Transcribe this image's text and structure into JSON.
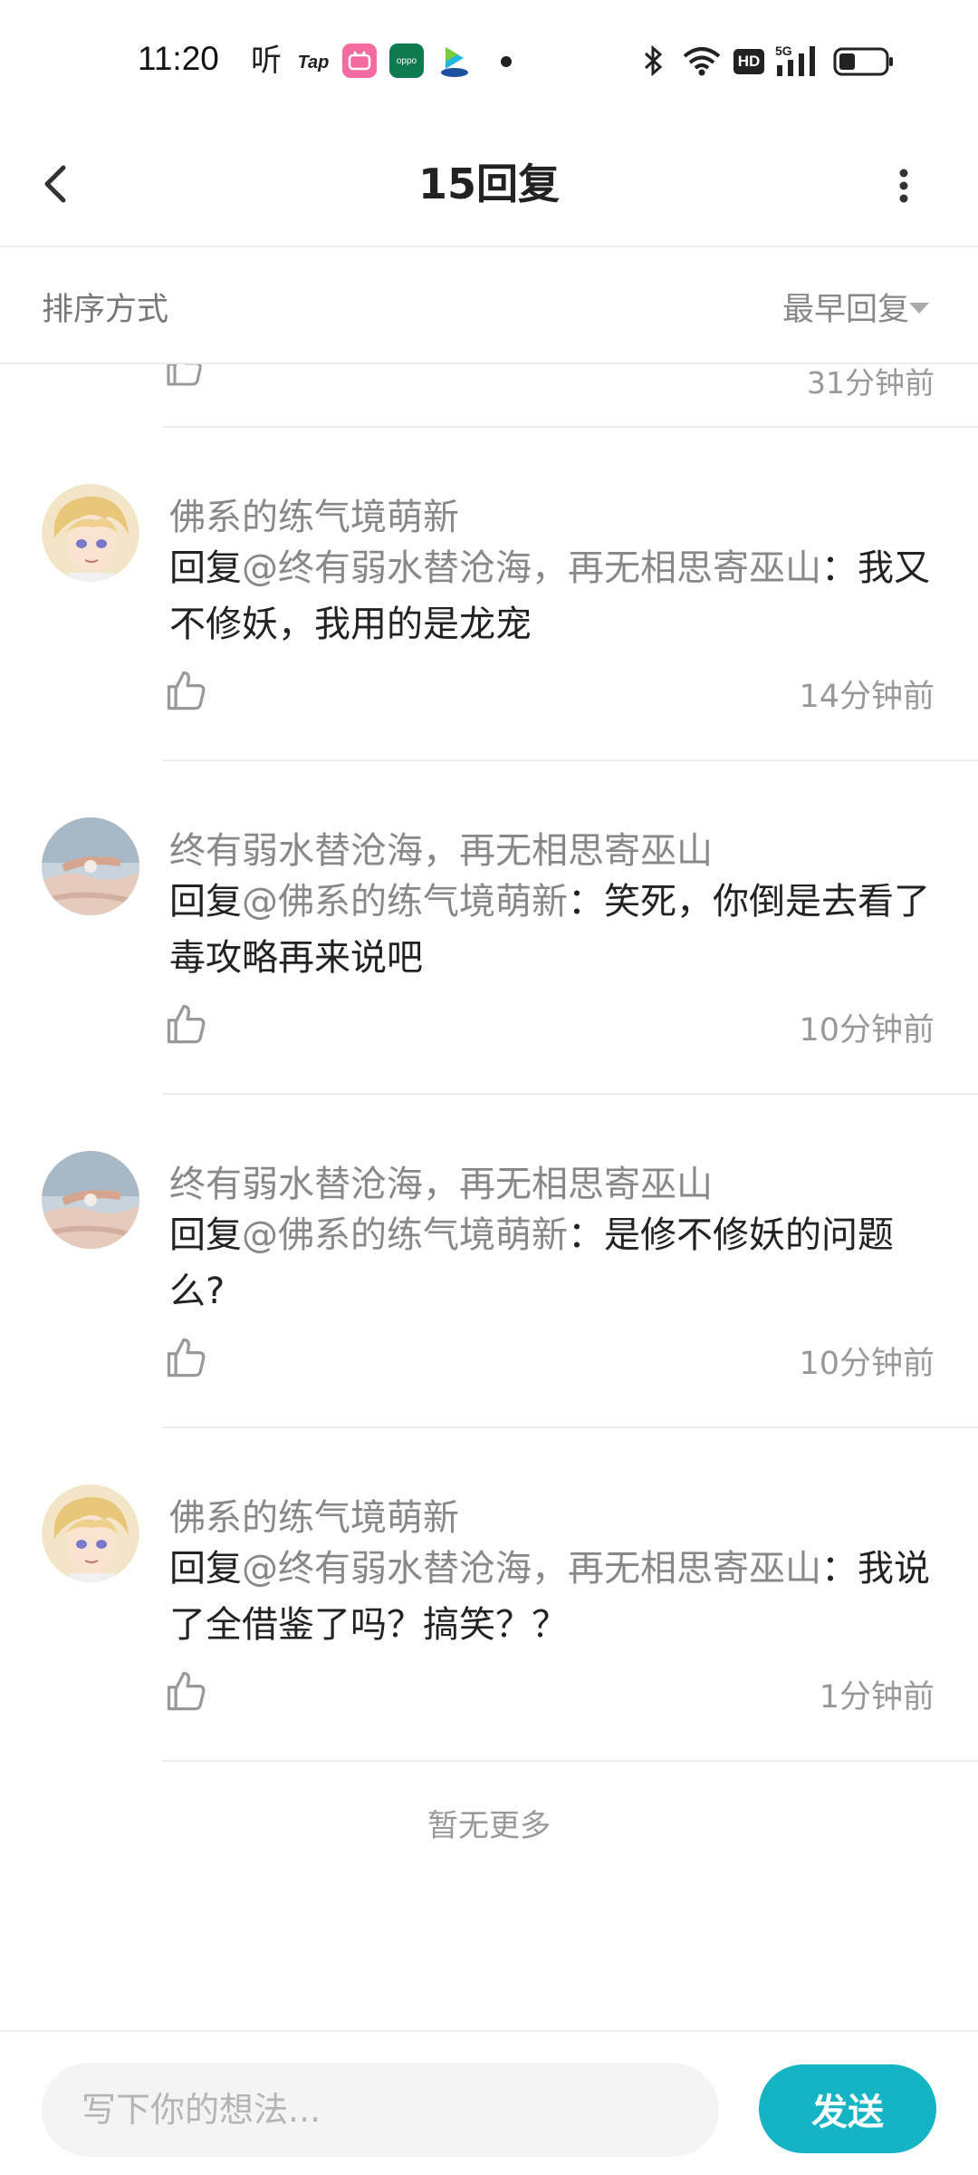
{
  "status_bar": {
    "time": "11:20",
    "icons": [
      "ting-icon",
      "tap-icon",
      "bilibili-icon",
      "oppo-icon",
      "video-play-icon",
      "notification-dot",
      "bluetooth-icon",
      "wifi-icon",
      "hd-icon",
      "signal-5g-icon",
      "battery-icon"
    ],
    "ting_glyph": "听",
    "tap_text": "Tap",
    "oppo_text": "oppo",
    "hd_text": "HD"
  },
  "header": {
    "title": "15回复"
  },
  "sort": {
    "label": "排序方式",
    "value": "最早回复"
  },
  "previous_reply": {
    "time": "31分钟前"
  },
  "replies": [
    {
      "username": "佛系的练气境萌新",
      "prefix": "回复",
      "mention": "@终有弱水替沧海，再无相思寄巫山",
      "text": "：我又不修妖，我用的是龙宠",
      "time": "14分钟前",
      "avatar": "blonde-boy-avatar"
    },
    {
      "username": "终有弱水替沧海，再无相思寄巫山",
      "prefix": "回复",
      "mention": "@佛系的练气境萌新",
      "text": "：笑死，你倒是去看了毒攻略再来说吧",
      "time": "10分钟前",
      "avatar": "hand-sky-avatar"
    },
    {
      "username": "终有弱水替沧海，再无相思寄巫山",
      "prefix": "回复",
      "mention": "@佛系的练气境萌新",
      "text": "：是修不修妖的问题么?",
      "time": "10分钟前",
      "avatar": "hand-sky-avatar"
    },
    {
      "username": "佛系的练气境萌新",
      "prefix": "回复",
      "mention": "@终有弱水替沧海，再无相思寄巫山",
      "text": "：我说了全借鉴了吗？搞笑？？",
      "time": "1分钟前",
      "avatar": "blonde-boy-avatar"
    }
  ],
  "footer_text": "暂无更多",
  "composer": {
    "placeholder": "写下你的想法...",
    "send_label": "发送"
  },
  "colors": {
    "accent": "#15b4c5",
    "muted_text": "#888888",
    "divider": "#ececec"
  }
}
